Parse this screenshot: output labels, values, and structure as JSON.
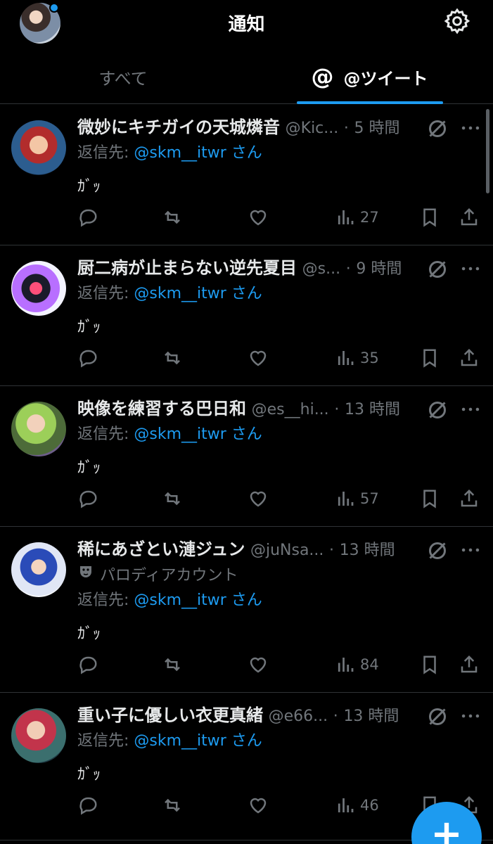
{
  "header": {
    "title": "通知",
    "avatar_icon": "user-avatar",
    "settings_icon": "gear-icon"
  },
  "tabs": [
    {
      "label": "すべて",
      "active": false
    },
    {
      "label": "@ツイート",
      "icon": "at-icon",
      "active": true
    }
  ],
  "tweets": [
    {
      "name": "微妙にキチガイの天城燐音",
      "handle": "@Kic...",
      "dot": "·",
      "time": "5 時間",
      "reply_prefix": "返信先: ",
      "reply_handle": "@skm__itwr さん",
      "text": "ｶﾞｯ",
      "views": "27"
    },
    {
      "name": "厨二病が止まらない逆先夏目",
      "handle": "@s...",
      "dot": "·",
      "time": "9 時間",
      "reply_prefix": "返信先: ",
      "reply_handle": "@skm__itwr さん",
      "text": "ｶﾞｯ",
      "views": "35"
    },
    {
      "name": "映像を練習する巴日和",
      "handle": "@es__hi...",
      "dot": "·",
      "time": "13 時間",
      "reply_prefix": "返信先: ",
      "reply_handle": "@skm__itwr さん",
      "text": "ｶﾞｯ",
      "views": "57"
    },
    {
      "name": "稀にあざとい漣ジュン",
      "handle": "@juNsa...",
      "dot": "·",
      "time": "13 時間",
      "parody_label": "パロディアカウント",
      "reply_prefix": "返信先: ",
      "reply_handle": "@skm__itwr さん",
      "text": "ｶﾞｯ",
      "views": "84"
    },
    {
      "name": "重い子に優しい衣更真緒",
      "handle": "@e66...",
      "dot": "·",
      "time": "13 時間",
      "reply_prefix": "返信先: ",
      "reply_handle": "@skm__itwr さん",
      "text": "ｶﾞｯ",
      "views": "46"
    }
  ],
  "fab": {
    "label": "+"
  },
  "colors": {
    "accent": "#1d9bf0",
    "background": "#000000",
    "muted": "#71767b",
    "divider": "#2f3336"
  }
}
